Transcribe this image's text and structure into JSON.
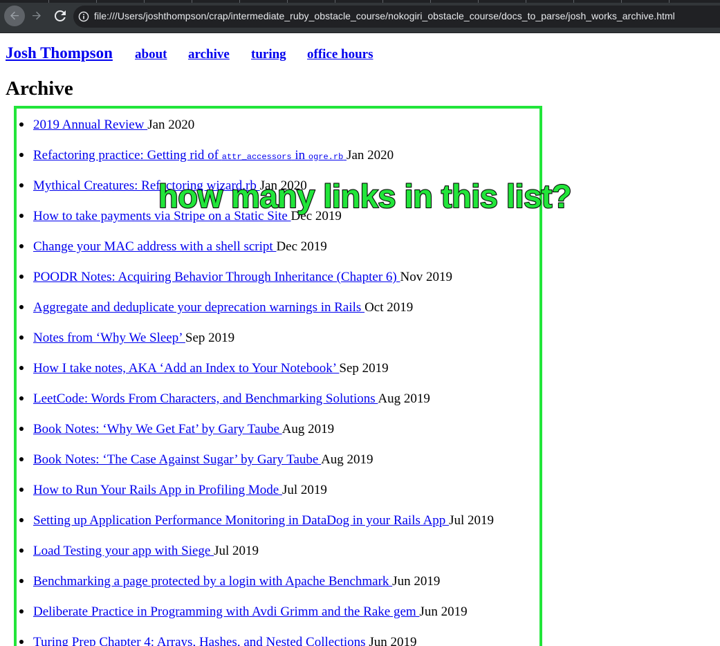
{
  "browser": {
    "url": "file:///Users/joshthompson/crap/intermediate_ruby_obstacle_course/nokogiri_obstacle_course/docs_to_parse/josh_works_archive.html",
    "icons": [
      "back-arrow-icon",
      "forward-arrow-icon",
      "reload-icon",
      "info-icon"
    ]
  },
  "site": {
    "title": "Josh Thompson",
    "nav": [
      {
        "label": "about"
      },
      {
        "label": "archive"
      },
      {
        "label": "turing"
      },
      {
        "label": "office hours"
      }
    ]
  },
  "page": {
    "heading": "Archive"
  },
  "archive": {
    "items": [
      {
        "title": "2019 Annual Review ",
        "date": "Jan 2020"
      },
      {
        "title_parts": [
          "Refactoring practice: Getting rid of ",
          "attr_accessors",
          " in ",
          "ogre.rb",
          " "
        ],
        "date": "Jan 2020"
      },
      {
        "title": "Mythical Creatures: Refactoring wizard.rb ",
        "date": "Jan 2020"
      },
      {
        "title": "How to take payments via Stripe on a Static Site ",
        "date": "Dec 2019"
      },
      {
        "title": "Change your MAC address with a shell script ",
        "date": "Dec 2019"
      },
      {
        "title": "POODR Notes: Acquiring Behavior Through Inheritance (Chapter 6) ",
        "date": "Nov 2019"
      },
      {
        "title": "Aggregate and deduplicate your deprecation warnings in Rails ",
        "date": "Oct 2019"
      },
      {
        "title": "Notes from ‘Why We Sleep’ ",
        "date": "Sep 2019"
      },
      {
        "title": "How I take notes, AKA ‘Add an Index to Your Notebook’ ",
        "date": "Sep 2019"
      },
      {
        "title": "LeetCode: Words From Characters, and Benchmarking Solutions ",
        "date": "Aug 2019"
      },
      {
        "title": "Book Notes: ‘Why We Get Fat’ by Gary Taube ",
        "date": "Aug 2019"
      },
      {
        "title": "Book Notes: ‘The Case Against Sugar’ by Gary Taube ",
        "date": "Aug 2019"
      },
      {
        "title": "How to Run Your Rails App in Profiling Mode ",
        "date": "Jul 2019"
      },
      {
        "title": "Setting up Application Performance Monitoring in DataDog in your Rails App ",
        "date": "Jul 2019"
      },
      {
        "title": "Load Testing your app with Siege ",
        "date": "Jul 2019"
      },
      {
        "title": "Benchmarking a page protected by a login with Apache Benchmark ",
        "date": "Jun 2019"
      },
      {
        "title": "Deliberate Practice in Programming with Avdi Grimm and the Rake gem ",
        "date": "Jun 2019"
      },
      {
        "title": "Turing Prep Chapter 4: Arrays, Hashes, and Nested Collections ",
        "date": "Jun 2019"
      }
    ]
  },
  "overlay": {
    "question": "how many links in this list?",
    "highlight_color": "#22e53a"
  }
}
